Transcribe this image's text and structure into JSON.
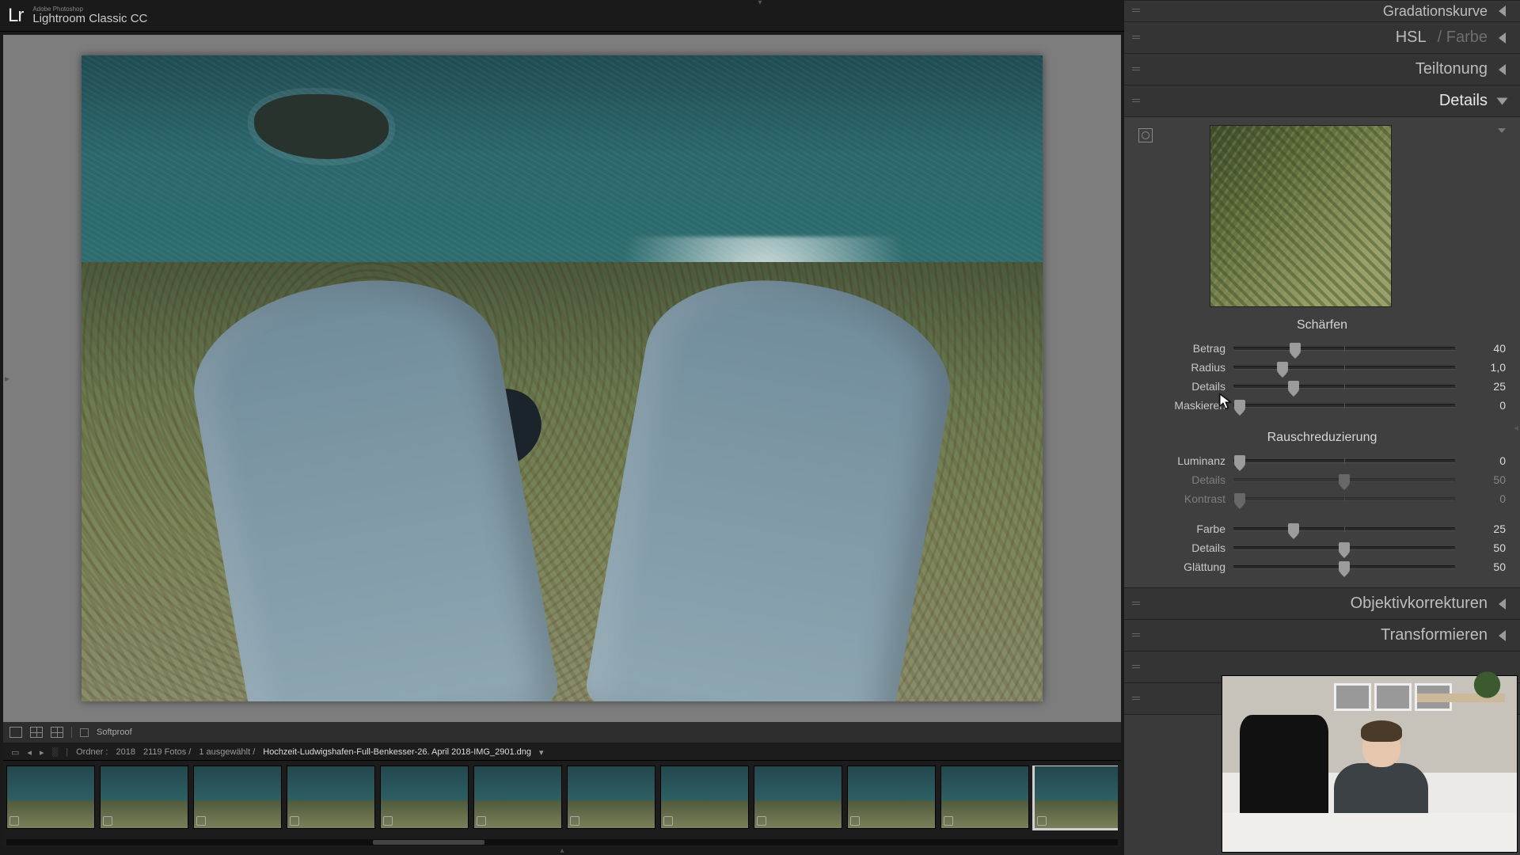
{
  "app": {
    "brand_short": "Lr",
    "brand_small": "Adobe Photoshop",
    "brand_title": "Lightroom Classic CC"
  },
  "under_toolbar": {
    "softproof_label": "Softproof"
  },
  "info_strip": {
    "prefix": "Ordner :",
    "year": "2018",
    "count": "2119 Fotos /",
    "selected": "1 ausgewählt /",
    "filename": "Hochzeit-Ludwigshafen-Full-Benkesser-26. April 2018-IMG_2901.dng",
    "caret": "▾"
  },
  "filmstrip": {
    "thumbs": [
      {
        "sel": false,
        "dark": false
      },
      {
        "sel": false,
        "dark": false
      },
      {
        "sel": false,
        "dark": false
      },
      {
        "sel": false,
        "dark": false
      },
      {
        "sel": false,
        "dark": false
      },
      {
        "sel": false,
        "dark": false
      },
      {
        "sel": false,
        "dark": false
      },
      {
        "sel": false,
        "dark": false
      },
      {
        "sel": false,
        "dark": false
      },
      {
        "sel": false,
        "dark": false
      },
      {
        "sel": false,
        "dark": false
      },
      {
        "sel": true,
        "dark": false
      },
      {
        "sel": false,
        "dark": true
      },
      {
        "sel": false,
        "dark": true
      },
      {
        "sel": false,
        "dark": true
      },
      {
        "sel": false,
        "dark": true
      },
      {
        "sel": false,
        "dark": true
      }
    ]
  },
  "panels": {
    "gradation": {
      "title": "Gradationskurve"
    },
    "hsl": {
      "title": "HSL",
      "sub": "/ Farbe"
    },
    "split": {
      "title": "Teiltonung"
    },
    "details": {
      "title": "Details"
    },
    "lens": {
      "title": "Objektivkorrekturen"
    },
    "transform": {
      "title": "Transformieren"
    }
  },
  "details_panel": {
    "sharpen": {
      "title": "Schärfen",
      "sliders": {
        "amount": {
          "label": "Betrag",
          "value": "40",
          "pos": 28
        },
        "radius": {
          "label": "Radius",
          "value": "1,0",
          "pos": 22
        },
        "detail": {
          "label": "Details",
          "value": "25",
          "pos": 27
        },
        "masking": {
          "label": "Maskieren",
          "value": "0",
          "pos": 3
        }
      }
    },
    "noise": {
      "title": "Rauschreduzierung",
      "sliders": {
        "luminance": {
          "label": "Luminanz",
          "value": "0",
          "pos": 3,
          "disabled": false
        },
        "lum_detail": {
          "label": "Details",
          "value": "50",
          "pos": 50,
          "disabled": true
        },
        "lum_contrast": {
          "label": "Kontrast",
          "value": "0",
          "pos": 3,
          "disabled": true
        },
        "color": {
          "label": "Farbe",
          "value": "25",
          "pos": 27,
          "disabled": false
        },
        "color_detail": {
          "label": "Details",
          "value": "50",
          "pos": 50,
          "disabled": false
        },
        "color_smooth": {
          "label": "Glättung",
          "value": "50",
          "pos": 50,
          "disabled": false
        }
      }
    }
  }
}
